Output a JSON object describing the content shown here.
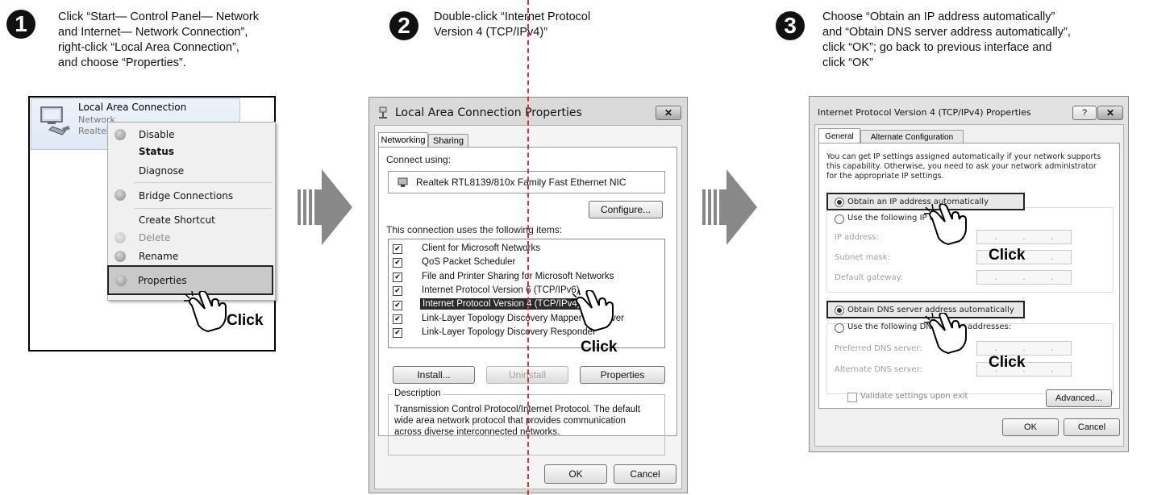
{
  "step1": {
    "number": "1",
    "instruction": [
      "Click “Start— Control Panel— Network",
      "and Internet— Network Connection”,",
      "right-click “Local Area Connection”,",
      "and choose “Properties”."
    ],
    "connection_title": "Local Area Connection",
    "connection_sub1": "Network",
    "connection_sub2": "Realtek",
    "menu": {
      "disable": "Disable",
      "status": "Status",
      "diagnose": "Diagnose",
      "bridge": "Bridge Connections",
      "shortcut": "Create Shortcut",
      "delete": "Delete",
      "rename": "Rename",
      "properties": "Properties"
    },
    "click_label": "Click"
  },
  "step2": {
    "number": "2",
    "instruction": [
      "Double-click “Internet Protocol",
      "Version 4 (TCP/IPv4)”"
    ],
    "title": "Local Area Connection Properties",
    "tabs": [
      "Networking",
      "Sharing"
    ],
    "connect_using_label": "Connect using:",
    "adapter": "Realtek RTL8139/810x Family Fast Ethernet NIC",
    "configure": "Configure...",
    "items_label": "This connection uses the following items:",
    "items": [
      "Client for Microsoft Networks",
      "QoS Packet Scheduler",
      "File and Printer Sharing for Microsoft Networks",
      "Internet Protocol Version 6 (TCP/IPv6)",
      "Internet Protocol Version 4 (TCP/IPv4)",
      "Link-Layer Topology Discovery Mapper I/O Driver",
      "Link-Layer Topology Discovery Responder"
    ],
    "install": "Install...",
    "uninstall": "Uninstall",
    "properties": "Properties",
    "description_label": "Description",
    "description": [
      "Transmission Control Protocol/Internet Protocol. The default",
      "wide area network protocol that provides communication",
      "across diverse interconnected networks."
    ],
    "ok": "OK",
    "cancel": "Cancel",
    "click_label": "Click"
  },
  "step3": {
    "number": "3",
    "instruction": [
      "Choose “Obtain an IP address automatically”",
      "and “Obtain DNS server address automatically”,",
      "click “OK”; go back to previous interface and",
      " click “OK”"
    ],
    "title": "Internet Protocol Version 4 (TCP/IPv4) Properties",
    "tabs": [
      "General",
      "Alternate Configuration"
    ],
    "intro": [
      "You can get IP settings assigned automatically if your network supports",
      "this capability. Otherwise, you need to ask your network administrator",
      "for the appropriate IP settings."
    ],
    "obtain_ip": "Obtain an IP address automatically",
    "use_ip": "Use the following IP address:",
    "ip_address": "IP address:",
    "subnet": "Subnet mask:",
    "gateway": "Default gateway:",
    "obtain_dns": "Obtain DNS server address automatically",
    "use_dns": "Use the following DNS server addresses:",
    "preferred_dns": "Preferred DNS server:",
    "alternate_dns": "Alternate DNS server:",
    "validate": "Validate settings upon exit",
    "advanced": "Advanced...",
    "ok": "OK",
    "cancel": "Cancel",
    "help": "?",
    "click_label": "Click"
  }
}
